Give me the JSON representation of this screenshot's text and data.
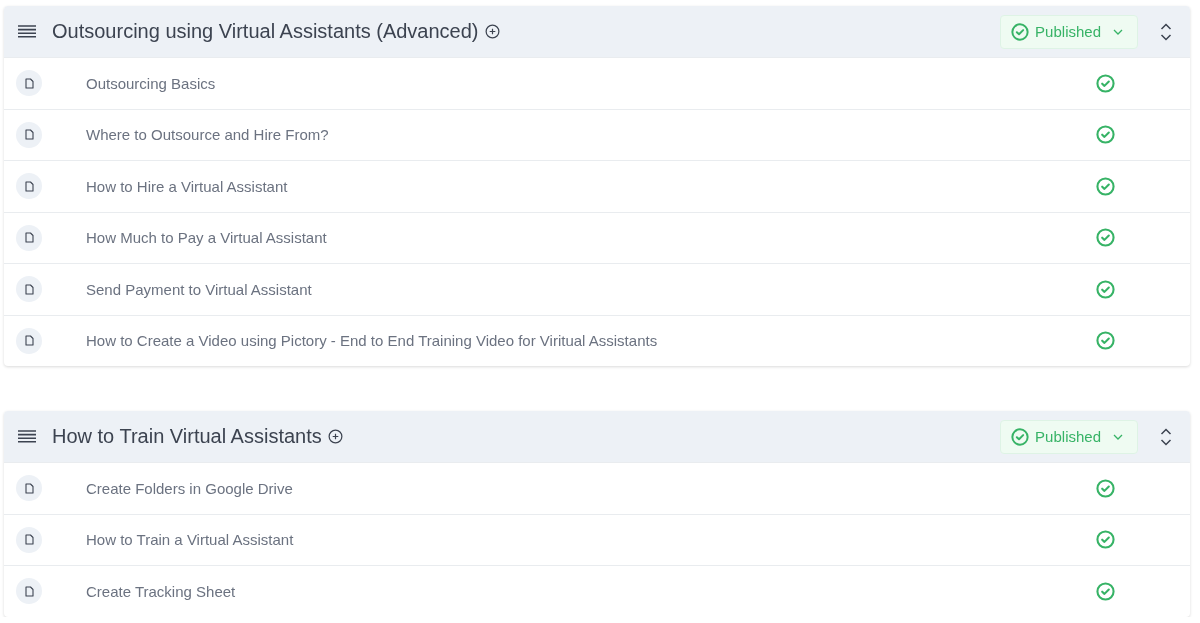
{
  "sections": [
    {
      "title": "Outsourcing using Virtual Assistants (Advanced)",
      "status": "Published",
      "lessons": [
        {
          "title": "Outsourcing Basics",
          "published": true
        },
        {
          "title": "Where to Outsource and Hire From?",
          "published": true
        },
        {
          "title": "How to Hire a Virtual Assistant",
          "published": true
        },
        {
          "title": "How Much to Pay a Virtual Assistant",
          "published": true
        },
        {
          "title": "Send Payment to Virtual Assistant",
          "published": true
        },
        {
          "title": "How to Create a Video using Pictory - End to End Training Video for Viritual Assistants",
          "published": true
        }
      ]
    },
    {
      "title": "How to Train Virtual Assistants",
      "status": "Published",
      "lessons": [
        {
          "title": "Create Folders in Google Drive",
          "published": true
        },
        {
          "title": "How to Train a Virtual Assistant",
          "published": true
        },
        {
          "title": "Create Tracking Sheet",
          "published": true
        }
      ]
    }
  ]
}
